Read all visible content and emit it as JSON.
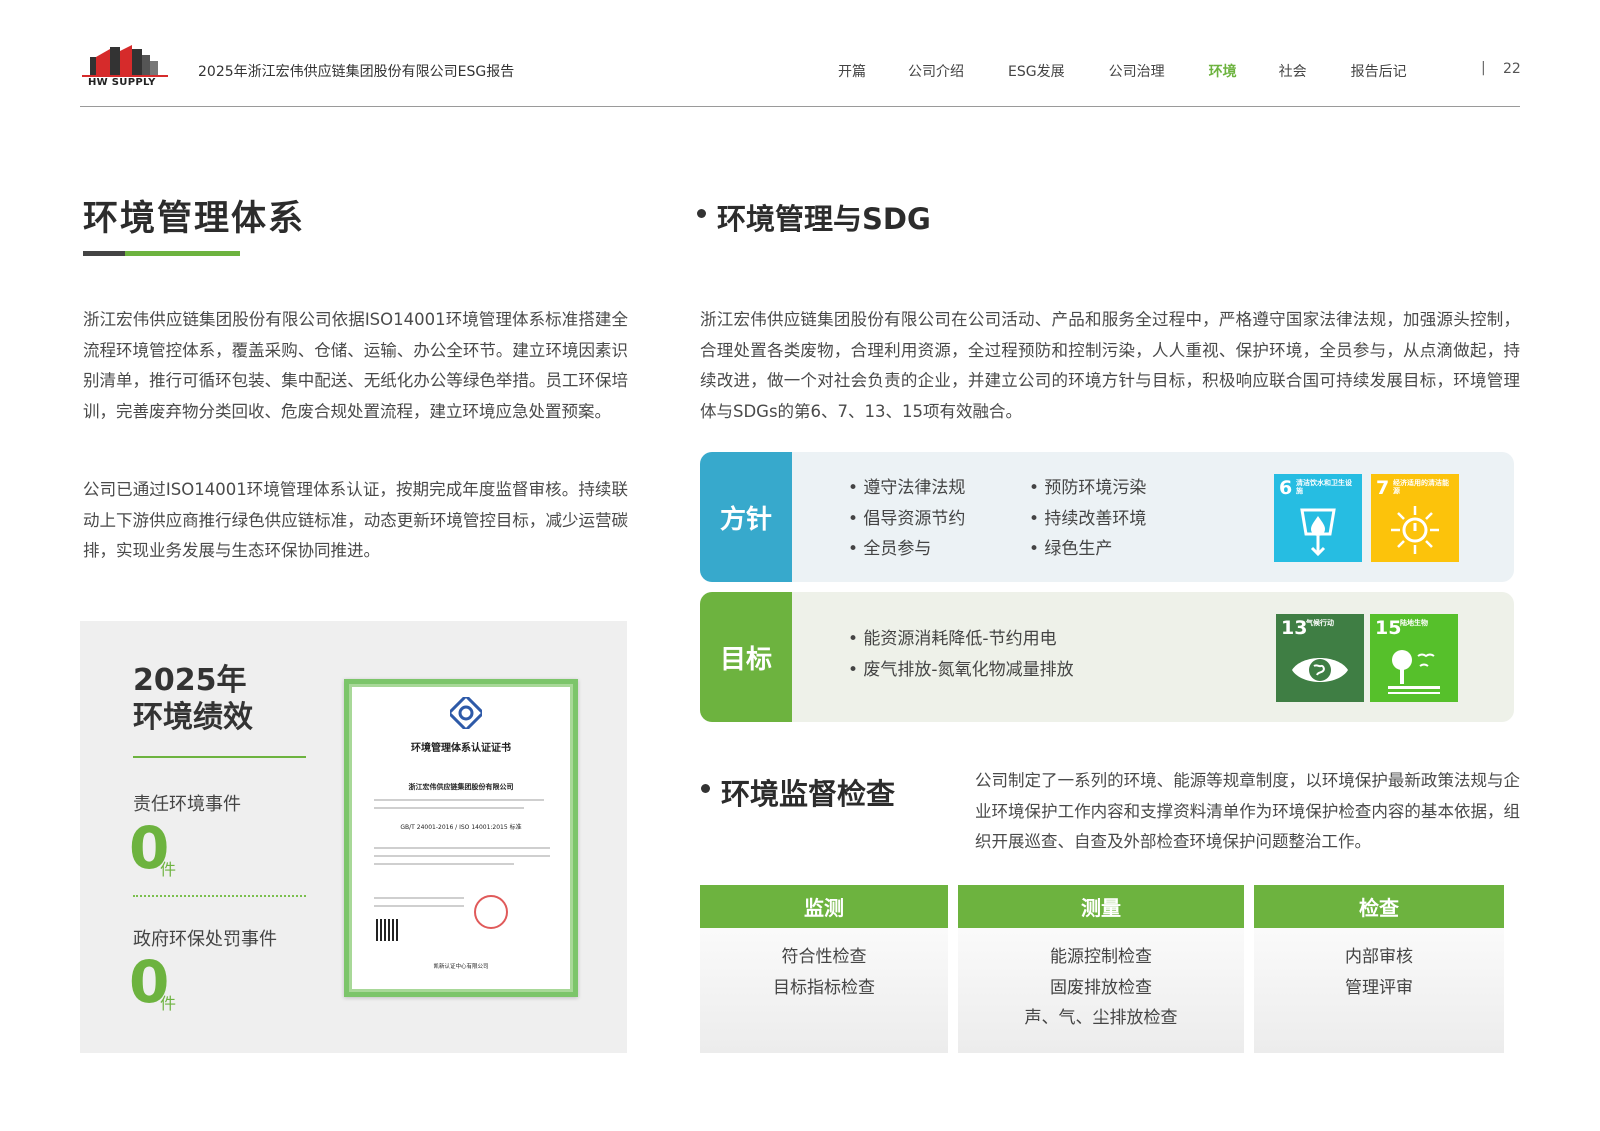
{
  "header": {
    "logo_text": "HW SUPPLY",
    "report_title": "2025年浙江宏伟供应链集团股份有限公司ESG报告",
    "nav": [
      "开篇",
      "公司介绍",
      "ESG发展",
      "公司治理",
      "环境",
      "社会",
      "报告后记"
    ],
    "active_nav": "环境",
    "separator": "|",
    "page_number": "22"
  },
  "left": {
    "section_title": "环境管理体系",
    "paragraphs": [
      "浙江宏伟供应链集团股份有限公司依据ISO14001环境管理体系标准搭建全流程环境管控体系，覆盖采购、仓储、运输、办公全环节。建立环境因素识别清单，推行可循环包装、集中配送、无纸化办公等绿色举措。员工环保培训，完善废弃物分类回收、危废合规处置流程，建立环境应急处置预案。",
      "公司已通过ISO14001环境管理体系认证，按期完成年度监督审核。持续联动上下游供应商推行绿色供应链标准，动态更新环境管控目标，减少运营碳排，实现业务发展与生态环保协同推进。"
    ],
    "performance": {
      "heading_line1": "2025年",
      "heading_line2": "环境绩效",
      "items": [
        {
          "label": "责任环境事件",
          "value": "0",
          "unit": "件"
        },
        {
          "label": "政府环保处罚事件",
          "value": "0",
          "unit": "件"
        }
      ]
    },
    "certificate": {
      "title": "环境管理体系认证证书",
      "company": "浙江宏伟供应链集团股份有限公司",
      "standard": "GB/T 24001-2016 / ISO 14001:2015 标准",
      "issuer": "凯新认证中心有限公司"
    }
  },
  "right": {
    "sdg_title": "环境管理与SDG",
    "sdg_paragraph": "浙江宏伟供应链集团股份有限公司在公司活动、产品和服务全过程中，严格遵守国家法律法规，加强源头控制，合理处置各类废物，合理利用资源，全过程预防和控制污染，人人重视、保护环境，全员参与，从点滴做起，持续改进，做一个对社会负责的企业，并建立公司的环境方针与目标，积极响应联合国可持续发展目标，环境管理体与SDGs的第6、7、13、15项有效融合。",
    "policy": {
      "tab": "方针",
      "col1": [
        "• 遵守法律法规",
        "• 倡导资源节约",
        "• 全员参与"
      ],
      "col2": [
        "• 预防环境污染",
        "• 持续改善环境",
        "• 绿色生产"
      ]
    },
    "goal": {
      "tab": "目标",
      "items": [
        "• 能资源消耗降低-节约用电",
        "• 废气排放-氮氧化物减量排放"
      ]
    },
    "sdgs": [
      {
        "num": "6",
        "label": "清洁饮水和卫生设施",
        "color": "#26bde2"
      },
      {
        "num": "7",
        "label": "经济适用的清洁能源",
        "color": "#fcc30b"
      },
      {
        "num": "13",
        "label": "气候行动",
        "color": "#3f7e44"
      },
      {
        "num": "15",
        "label": "陆地生物",
        "color": "#56c02b"
      }
    ],
    "inspection_title": "环境监督检查",
    "inspection_paragraph": "公司制定了一系列的环境、能源等规章制度，以环境保护最新政策法规与企业环境保护工作内容和支撑资料清单作为环境保护检查内容的基本依据，组织开展巡查、自查及外部检查环境保护问题整治工作。",
    "inspection_columns": [
      {
        "head": "监测",
        "items": [
          "符合性检查",
          "目标指标检查"
        ]
      },
      {
        "head": "测量",
        "items": [
          "能源控制检查",
          "固废排放检查",
          "声、气、尘排放检查"
        ]
      },
      {
        "head": "检查",
        "items": [
          "内部审核",
          "管理评审"
        ]
      }
    ]
  },
  "colors": {
    "accent_green": "#6db33f",
    "policy_blue": "#37a9cc"
  }
}
